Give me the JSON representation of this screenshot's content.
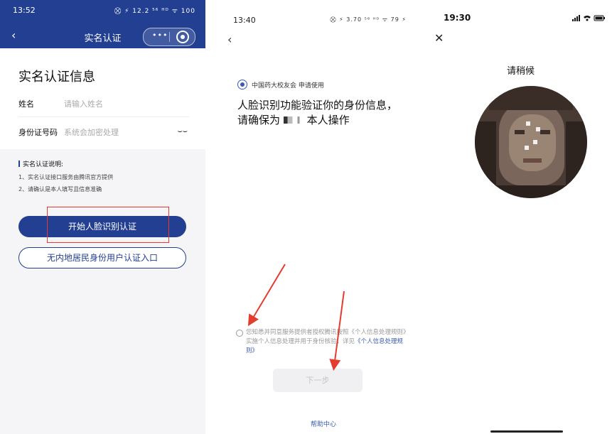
{
  "panel1": {
    "status_time": "13:52",
    "status_right": "⛒ ⚡ 12.2 ⁵⁶ ᴴᴰ ᯤ 100",
    "back_icon": "‹",
    "title": "实名认证",
    "capsule_dots": "•••",
    "heading": "实名认证信息",
    "name_label": "姓名",
    "name_placeholder": "请输入姓名",
    "id_label": "身份证号码",
    "id_placeholder": "系统会加密处理",
    "id_eye_icon": "⌣⌣",
    "notes_title": "实名认证说明:",
    "notes": [
      "1、实名认证接口服务由腾讯官方提供",
      "2、请确认是本人填写且信息准确"
    ],
    "primary_button": "开始人脸识别认证",
    "secondary_button": "无内地居民身份用户认证入口",
    "accent_color": "#233f91",
    "annotation_color": "#e43c2f"
  },
  "panel2": {
    "status_time": "13:40",
    "status_right": "⛒ ⚡ 3.70 ⁵⁶ ᴴᴰ ᯤ 79 ⚡",
    "back_icon": "‹",
    "app_name": "中国药大校友会 申请使用",
    "heading_line1": "人脸识别功能验证你的身份信息，",
    "heading_line2_prefix": "请确保为",
    "heading_line2_suffix": "本人操作",
    "consent_text": "您知悉并同意服务提供者授权腾讯按照《个人信息处理规则》实施个人信息处理并用于身份核验，详见",
    "consent_link": "《个人信息处理规则》",
    "next_button": "下一步",
    "help_link": "帮助中心",
    "link_color": "#3a5cae"
  },
  "panel3": {
    "status_time": "19:30",
    "close_icon": "✕",
    "title": "请稍候"
  }
}
